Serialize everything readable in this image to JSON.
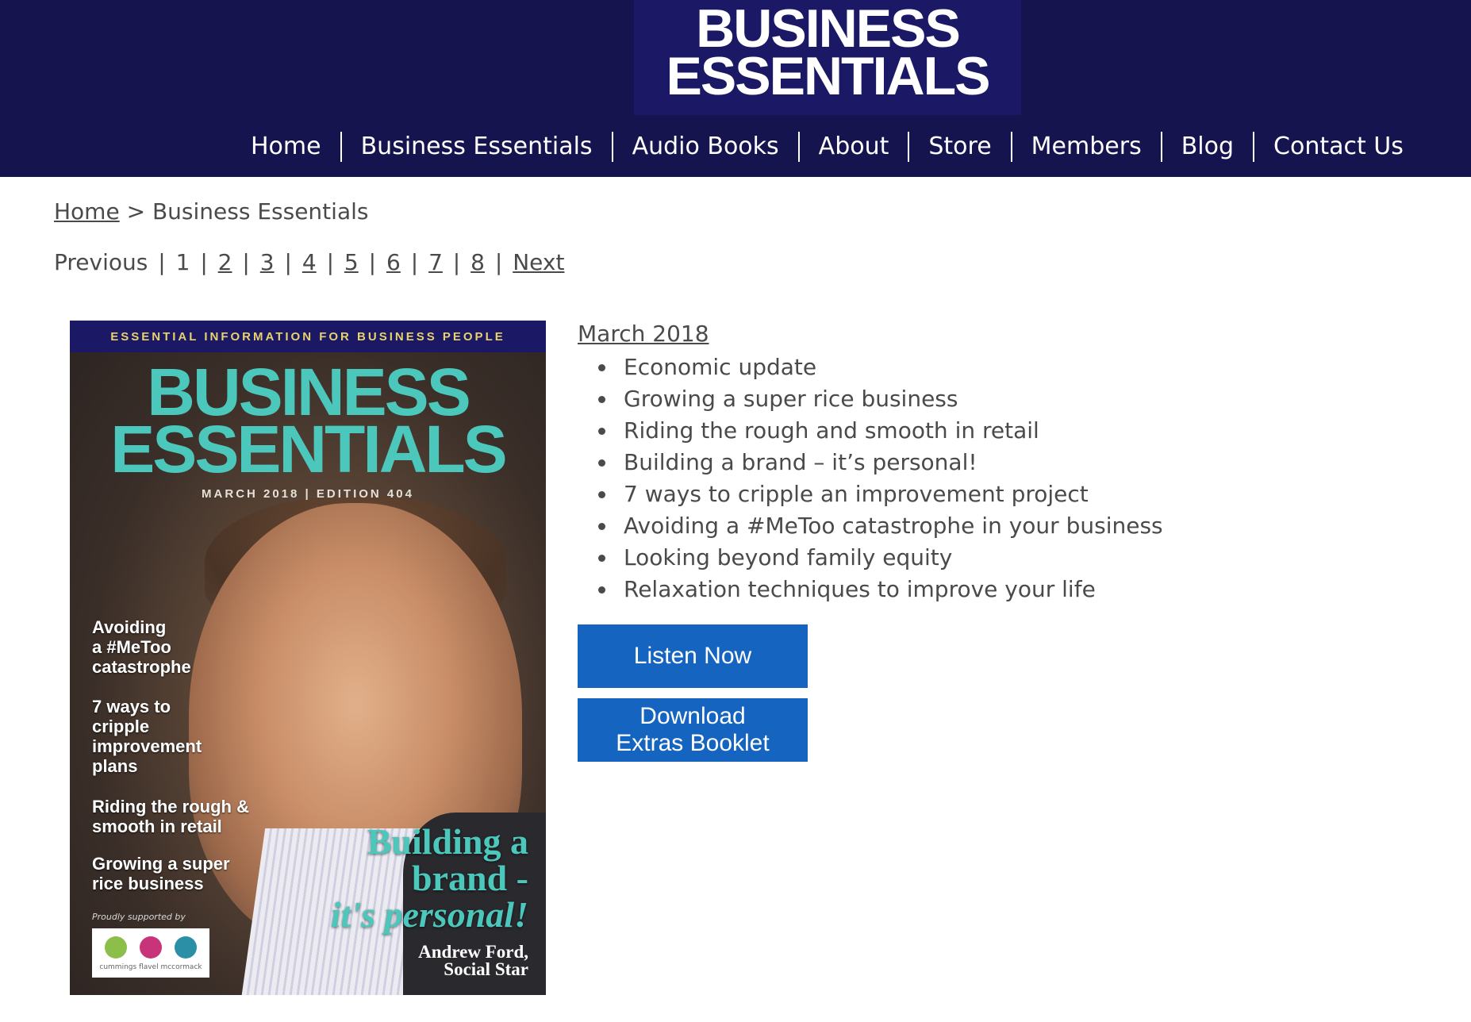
{
  "logo": {
    "line1": "BUSINESS",
    "line2": "ESSENTIALS"
  },
  "nav": {
    "items": [
      {
        "label": "Home"
      },
      {
        "label": "Business Essentials"
      },
      {
        "label": "Audio Books"
      },
      {
        "label": "About"
      },
      {
        "label": "Store"
      },
      {
        "label": "Members"
      },
      {
        "label": "Blog"
      },
      {
        "label": "Contact Us"
      }
    ]
  },
  "breadcrumb": {
    "home": "Home",
    "separator": ">",
    "current": "Business Essentials"
  },
  "pager": {
    "previous": "Previous",
    "current": "1",
    "pages": [
      "2",
      "3",
      "4",
      "5",
      "6",
      "7",
      "8"
    ],
    "next": "Next",
    "separator": "|"
  },
  "cover": {
    "tagline": "ESSENTIAL INFORMATION FOR BUSINESS PEOPLE",
    "title_line1": "BUSINESS",
    "title_line2": "ESSENTIALS",
    "edition": "MARCH 2018 | EDITION 404",
    "side_stories": [
      [
        "Avoiding",
        "a #MeToo",
        "catastrophe"
      ],
      [
        "7 ways to",
        "cripple",
        "improvement",
        "plans"
      ],
      [
        "Riding the rough &",
        "smooth in retail"
      ],
      [
        "Growing a super",
        "rice business"
      ]
    ],
    "supported_by": "Proudly supported by",
    "sponsor_name": "cummings flavel mccormack",
    "feature_line1": "Building a",
    "feature_line2": "brand -",
    "feature_line3": "it's personal!",
    "name_line1": "Andrew Ford,",
    "name_line2": "Social Star"
  },
  "issue": {
    "title": "March 2018",
    "topics": [
      "Economic update",
      "Growing a super rice business",
      "Riding the rough and smooth in retail",
      "Building a brand – it’s personal!",
      "7 ways to cripple an improvement project",
      "Avoiding a #MeToo catastrophe in your business",
      "Looking beyond family equity",
      "Relaxation techniques to improve your life"
    ]
  },
  "buttons": {
    "listen": "Listen Now",
    "download_line1": "Download",
    "download_line2": "Extras Booklet"
  },
  "colors": {
    "header_bg": "#16144f",
    "logo_bg": "#1b1965",
    "button_bg": "#1565c0",
    "cover_accent": "#4cc7bc",
    "text": "#4a4a4a"
  }
}
